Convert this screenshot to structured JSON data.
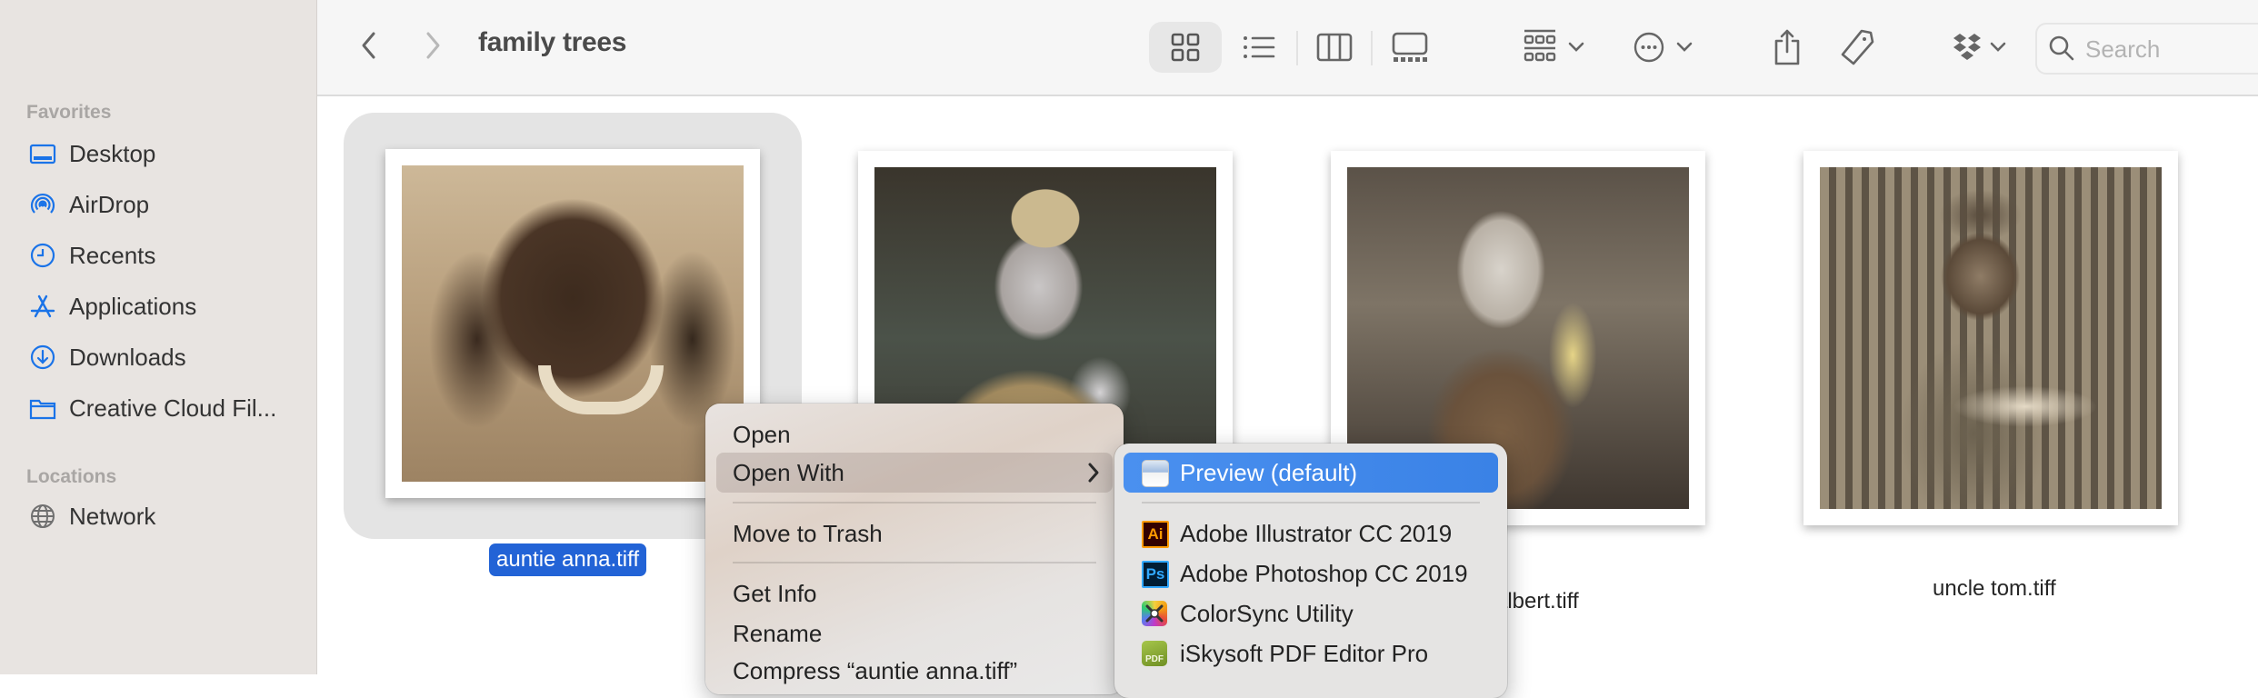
{
  "window": {
    "title": "family trees"
  },
  "sidebar": {
    "sections": [
      {
        "heading": "Favorites",
        "items": [
          {
            "label": "Desktop",
            "icon": "desktop-icon"
          },
          {
            "label": "AirDrop",
            "icon": "airdrop-icon"
          },
          {
            "label": "Recents",
            "icon": "clock-icon"
          },
          {
            "label": "Applications",
            "icon": "applications-icon"
          },
          {
            "label": "Downloads",
            "icon": "download-icon"
          },
          {
            "label": "Creative Cloud Fil...",
            "icon": "folder-icon"
          }
        ]
      },
      {
        "heading": "Locations",
        "items": [
          {
            "label": "Network",
            "icon": "globe-icon"
          }
        ]
      }
    ],
    "accent_color": "#1a73e8"
  },
  "toolbar": {
    "back": "chevron-left-icon",
    "forward": "chevron-right-icon",
    "view_modes": [
      "icon",
      "list",
      "column",
      "gallery"
    ],
    "active_view": "icon",
    "group_by": "group-icon",
    "more": "ellipsis-icon",
    "share": "share-icon",
    "tag": "tag-icon",
    "dropbox": "dropbox-icon",
    "search": {
      "placeholder": "Search"
    }
  },
  "files": [
    {
      "name": "auntie anna.tiff",
      "selected": true,
      "tone": "sepia"
    },
    {
      "name": "",
      "selected": false,
      "tone": "color-military"
    },
    {
      "name": "albert.tiff",
      "selected": false,
      "tone": "sepia-crowd"
    },
    {
      "name": "uncle tom.tiff",
      "selected": false,
      "tone": "sepia-pilot"
    }
  ],
  "context_menu": {
    "items": [
      {
        "label": "Open"
      },
      {
        "label": "Open With",
        "has_submenu": true,
        "highlighted": true
      },
      {
        "separator": true
      },
      {
        "label": "Move to Trash"
      },
      {
        "separator": true
      },
      {
        "label": "Get Info"
      },
      {
        "label": "Rename"
      },
      {
        "label": "Compress “auntie anna.tiff”"
      }
    ]
  },
  "open_with_submenu": {
    "items": [
      {
        "label": "Preview (default)",
        "icon": "preview-app-icon",
        "active": true
      },
      {
        "separator": true
      },
      {
        "label": "Adobe Illustrator CC 2019",
        "icon": "illustrator-app-icon",
        "badge": "Ai"
      },
      {
        "label": "Adobe Photoshop CC 2019",
        "icon": "photoshop-app-icon",
        "badge": "Ps"
      },
      {
        "label": "ColorSync Utility",
        "icon": "colorsync-app-icon"
      },
      {
        "label": "iSkysoft PDF Editor Pro",
        "icon": "iskysoft-app-icon",
        "badge": "PDF"
      }
    ],
    "highlight_color": "#3a82e6"
  }
}
